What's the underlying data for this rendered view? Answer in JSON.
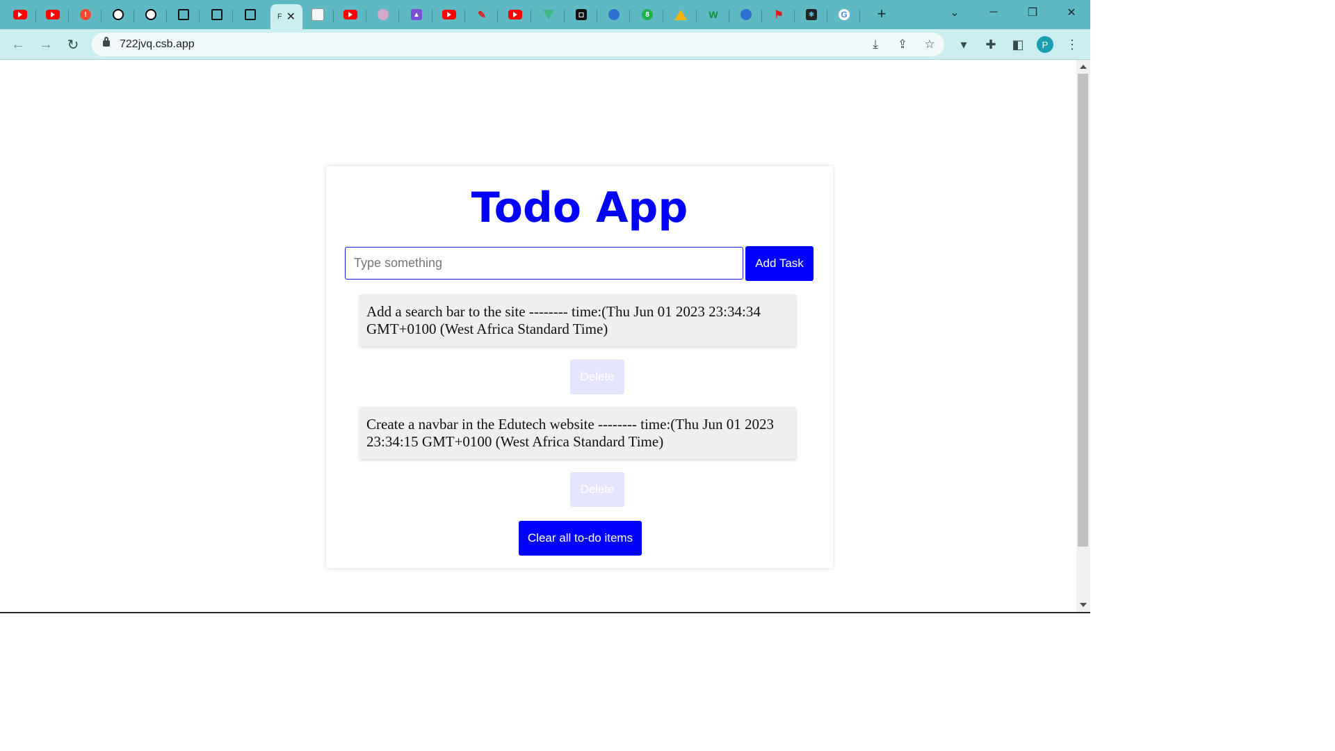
{
  "browser": {
    "tabs": [
      {
        "icon": "youtube-icon"
      },
      {
        "icon": "youtube-icon"
      },
      {
        "icon": "alert-icon"
      },
      {
        "icon": "codepen-icon"
      },
      {
        "icon": "codepen-icon"
      },
      {
        "icon": "square-icon"
      },
      {
        "icon": "square-icon"
      },
      {
        "icon": "square-icon"
      },
      {
        "icon": "page-icon",
        "title": "F",
        "active": true
      },
      {
        "icon": "note-icon"
      },
      {
        "icon": "youtube-icon"
      },
      {
        "icon": "chatgpt-icon"
      },
      {
        "icon": "rocket-icon"
      },
      {
        "icon": "youtube-icon"
      },
      {
        "icon": "pen-icon"
      },
      {
        "icon": "youtube-icon"
      },
      {
        "icon": "vue-icon"
      },
      {
        "icon": "black-square-icon"
      },
      {
        "icon": "globe-icon"
      },
      {
        "icon": "whatsapp-icon"
      },
      {
        "icon": "google-drive-icon"
      },
      {
        "icon": "w-icon"
      },
      {
        "icon": "globe-icon"
      },
      {
        "icon": "flag-icon"
      },
      {
        "icon": "react-icon"
      },
      {
        "icon": "google-icon"
      }
    ],
    "active_tab_title": "F",
    "url": "722jvq.csb.app",
    "profile_initial": "P"
  },
  "app": {
    "title": "Todo App",
    "input": {
      "value": "",
      "placeholder": "Type something"
    },
    "add_button_label": "Add Task",
    "todos": [
      {
        "text": "Add a search bar to the site -------- time:(Thu Jun 01 2023 23:34:34 GMT+0100 (West Africa Standard Time)",
        "delete_label": "Delete"
      },
      {
        "text": "Create a navbar in the Edutech website -------- time:(Thu Jun 01 2023 23:34:15 GMT+0100 (West Africa Standard Time)",
        "delete_label": "Delete"
      }
    ],
    "clear_button_label": "Clear all to-do items"
  },
  "colors": {
    "accent": "#0000ff",
    "tab_bar": "#5fb9c3",
    "toolbar": "#cdeef0",
    "todo_bg": "#efefef",
    "delete_bg": "#e4e4ff"
  }
}
